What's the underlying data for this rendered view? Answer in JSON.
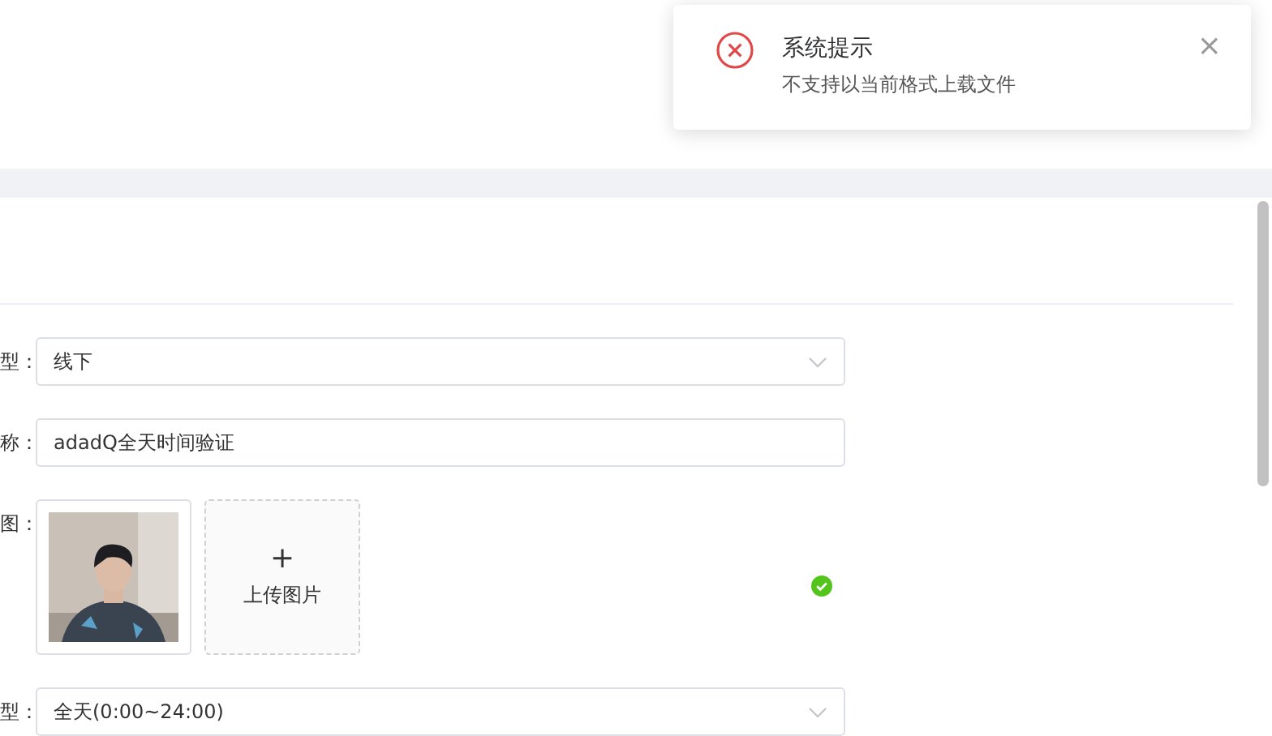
{
  "notification": {
    "kind": "error",
    "title": "系统提示",
    "message": "不支持以当前格式上载文件",
    "close": "×"
  },
  "form": {
    "rows": [
      {
        "kind": "select",
        "label": "型：",
        "value": "线下"
      },
      {
        "kind": "input",
        "label": "称：",
        "value": "adadQ全天时间验证"
      },
      {
        "kind": "upload",
        "label": "图：",
        "upload_icon": "+",
        "upload_label": "上传图片",
        "valid": true
      },
      {
        "kind": "select",
        "label": "型：",
        "value": "全天(0:00~24:00)"
      }
    ]
  }
}
